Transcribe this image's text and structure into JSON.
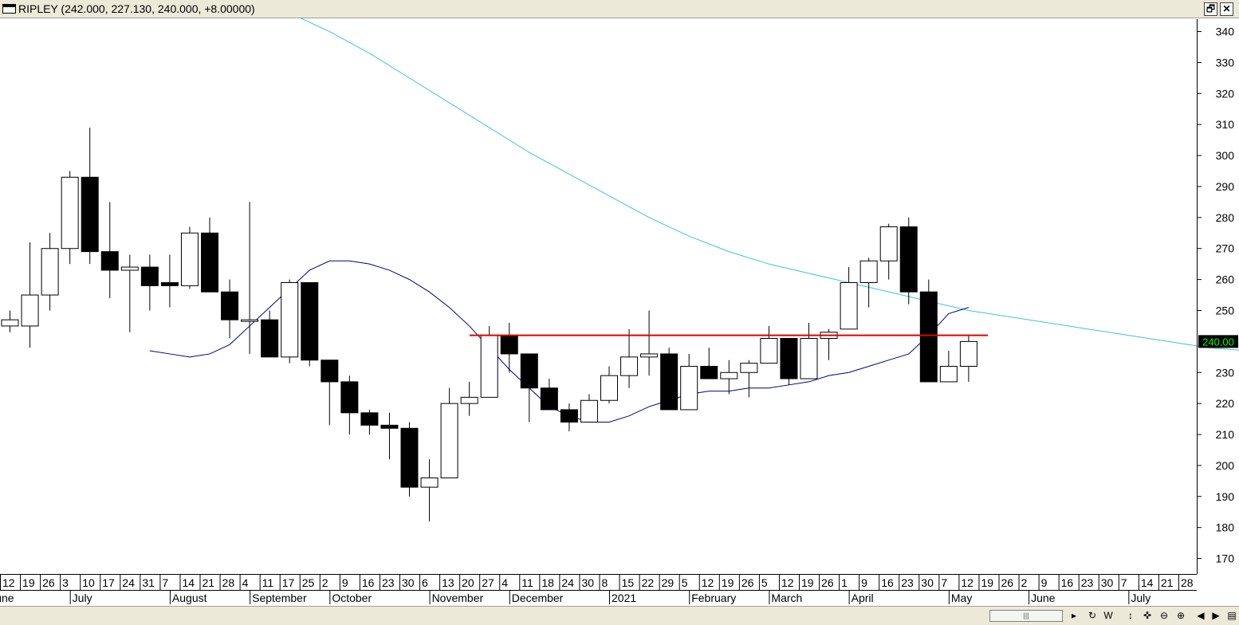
{
  "window": {
    "title": "RIPLEY (242.000, 227.130, 240.000, +8.00000)",
    "restore_label": "🗗",
    "close_label": "✕"
  },
  "colors": {
    "up_fill": "#ffffff",
    "down_fill": "#000000",
    "ma_short": "#00008b",
    "ma_long": "#3cc8c8",
    "resistance": "#e00000",
    "last_price_bg": "#000000",
    "last_price_fg": "#00ff00"
  },
  "chart_data": {
    "type": "candlestick",
    "ylim": [
      165,
      344
    ],
    "yticks": [
      340,
      330,
      320,
      310,
      300,
      290,
      280,
      270,
      260,
      250,
      230,
      220,
      210,
      200,
      190,
      180,
      170
    ],
    "last_price_label": "240.00",
    "last_price": 240,
    "resistance_level": 242,
    "xtick_labels": [
      "12",
      "19",
      "26",
      "3",
      "10",
      "17",
      "24",
      "31",
      "7",
      "14",
      "21",
      "28",
      "4",
      "11",
      "17",
      "25",
      "2",
      "9",
      "16",
      "23",
      "30",
      "6",
      "13",
      "20",
      "27",
      "4",
      "11",
      "18",
      "24",
      "30",
      "8",
      "15",
      "22",
      "29",
      "5",
      "12",
      "19",
      "26",
      "5",
      "12",
      "19",
      "26",
      "1",
      "9",
      "16",
      "23",
      "30",
      "7",
      "12",
      "19",
      "26",
      "2",
      "9",
      "16",
      "23",
      "30",
      "7",
      "14",
      "21",
      "28"
    ],
    "month_labels": [
      "une",
      "July",
      "August",
      "September",
      "October",
      "November",
      "December",
      "2021",
      "February",
      "March",
      "April",
      "May",
      "June",
      "July"
    ],
    "candles": [
      {
        "o": 245,
        "h": 250,
        "l": 243,
        "c": 247
      },
      {
        "o": 245,
        "h": 272,
        "l": 238,
        "c": 255
      },
      {
        "o": 255,
        "h": 275,
        "l": 250,
        "c": 270
      },
      {
        "o": 270,
        "h": 295,
        "l": 265,
        "c": 293
      },
      {
        "o": 293,
        "h": 309,
        "l": 265,
        "c": 269
      },
      {
        "o": 269,
        "h": 285,
        "l": 254,
        "c": 263
      },
      {
        "o": 263,
        "h": 268,
        "l": 243,
        "c": 264
      },
      {
        "o": 264,
        "h": 268,
        "l": 250,
        "c": 258
      },
      {
        "o": 259,
        "h": 268,
        "l": 251,
        "c": 258
      },
      {
        "o": 258,
        "h": 277,
        "l": 257,
        "c": 275
      },
      {
        "o": 275,
        "h": 280,
        "l": 256,
        "c": 256
      },
      {
        "o": 256,
        "h": 260,
        "l": 241,
        "c": 247
      },
      {
        "o": 247,
        "h": 285,
        "l": 236,
        "c": 247
      },
      {
        "o": 247,
        "h": 250,
        "l": 235,
        "c": 235
      },
      {
        "o": 235,
        "h": 260,
        "l": 233,
        "c": 259
      },
      {
        "o": 259,
        "h": 259,
        "l": 232,
        "c": 234
      },
      {
        "o": 234,
        "h": 234,
        "l": 213,
        "c": 227
      },
      {
        "o": 227,
        "h": 229,
        "l": 210,
        "c": 217
      },
      {
        "o": 217,
        "h": 218,
        "l": 210,
        "c": 213
      },
      {
        "o": 213,
        "h": 217,
        "l": 202,
        "c": 212
      },
      {
        "o": 212,
        "h": 214,
        "l": 190,
        "c": 193
      },
      {
        "o": 193,
        "h": 202,
        "l": 182,
        "c": 196
      },
      {
        "o": 196,
        "h": 225,
        "l": 197,
        "c": 220
      },
      {
        "o": 220,
        "h": 227,
        "l": 216,
        "c": 222
      },
      {
        "o": 222,
        "h": 245,
        "l": 222,
        "c": 242
      },
      {
        "o": 242,
        "h": 246,
        "l": 230,
        "c": 236
      },
      {
        "o": 236,
        "h": 236,
        "l": 214,
        "c": 225
      },
      {
        "o": 225,
        "h": 228,
        "l": 218,
        "c": 218
      },
      {
        "o": 218,
        "h": 220,
        "l": 211,
        "c": 214
      },
      {
        "o": 214,
        "h": 223,
        "l": 214,
        "c": 221
      },
      {
        "o": 221,
        "h": 232,
        "l": 220,
        "c": 229
      },
      {
        "o": 229,
        "h": 244,
        "l": 225,
        "c": 235
      },
      {
        "o": 235,
        "h": 250,
        "l": 229,
        "c": 236
      },
      {
        "o": 236,
        "h": 238,
        "l": 218,
        "c": 218
      },
      {
        "o": 218,
        "h": 236,
        "l": 218,
        "c": 232
      },
      {
        "o": 232,
        "h": 238,
        "l": 228,
        "c": 228
      },
      {
        "o": 228,
        "h": 234,
        "l": 223,
        "c": 230
      },
      {
        "o": 230,
        "h": 234,
        "l": 222,
        "c": 233
      },
      {
        "o": 233,
        "h": 245,
        "l": 233,
        "c": 241
      },
      {
        "o": 241,
        "h": 241,
        "l": 226,
        "c": 228
      },
      {
        "o": 228,
        "h": 246,
        "l": 228,
        "c": 241
      },
      {
        "o": 241,
        "h": 244,
        "l": 234,
        "c": 243
      },
      {
        "o": 244,
        "h": 264,
        "l": 244,
        "c": 259
      },
      {
        "o": 259,
        "h": 267,
        "l": 251,
        "c": 266
      },
      {
        "o": 266,
        "h": 278,
        "l": 260,
        "c": 277
      },
      {
        "o": 277,
        "h": 280,
        "l": 252,
        "c": 256
      },
      {
        "o": 256,
        "h": 260,
        "l": 227,
        "c": 227
      },
      {
        "o": 227,
        "h": 237,
        "l": 227,
        "c": 232
      },
      {
        "o": 232,
        "h": 242,
        "l": 227,
        "c": 240
      }
    ],
    "ma_short": [
      237,
      236,
      235,
      236,
      239,
      245,
      251,
      257,
      263,
      266,
      266,
      265,
      263,
      260,
      256,
      251,
      245,
      238,
      231,
      225,
      219,
      216,
      214,
      214,
      216,
      219,
      221,
      223,
      224,
      224,
      225,
      225,
      226,
      227,
      229,
      230,
      232,
      234,
      236,
      242,
      249,
      251
    ],
    "ma_long": [
      346,
      340,
      333,
      325,
      317,
      309,
      301,
      294,
      287,
      280,
      274,
      269,
      265,
      262,
      259,
      256,
      253,
      250,
      248,
      246,
      244,
      242,
      240,
      238,
      237
    ]
  }
}
